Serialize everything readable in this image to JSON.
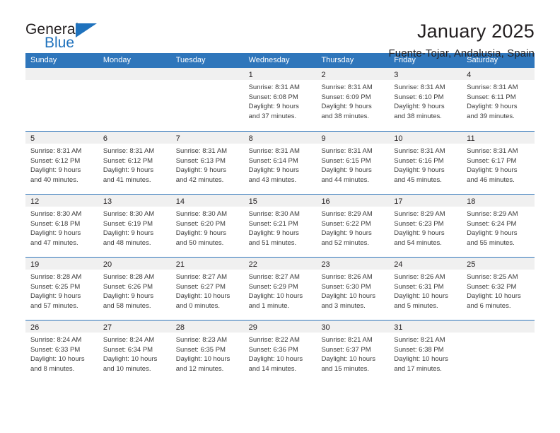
{
  "brand": {
    "name_part1": "General",
    "name_part2": "Blue",
    "accent_color": "#1f72bd",
    "triangle_icon": "triangle-icon"
  },
  "header": {
    "title": "January 2025",
    "subtitle": "Fuente-Tojar, Andalusia, Spain"
  },
  "calendar": {
    "header_bg": "#2f76bb",
    "day_band_bg": "#f0f0f0",
    "weekdays": [
      "Sunday",
      "Monday",
      "Tuesday",
      "Wednesday",
      "Thursday",
      "Friday",
      "Saturday"
    ],
    "weeks": [
      [
        {
          "day": "",
          "lines": []
        },
        {
          "day": "",
          "lines": []
        },
        {
          "day": "",
          "lines": []
        },
        {
          "day": "1",
          "lines": [
            "Sunrise: 8:31 AM",
            "Sunset: 6:08 PM",
            "Daylight: 9 hours",
            "and 37 minutes."
          ]
        },
        {
          "day": "2",
          "lines": [
            "Sunrise: 8:31 AM",
            "Sunset: 6:09 PM",
            "Daylight: 9 hours",
            "and 38 minutes."
          ]
        },
        {
          "day": "3",
          "lines": [
            "Sunrise: 8:31 AM",
            "Sunset: 6:10 PM",
            "Daylight: 9 hours",
            "and 38 minutes."
          ]
        },
        {
          "day": "4",
          "lines": [
            "Sunrise: 8:31 AM",
            "Sunset: 6:11 PM",
            "Daylight: 9 hours",
            "and 39 minutes."
          ]
        }
      ],
      [
        {
          "day": "5",
          "lines": [
            "Sunrise: 8:31 AM",
            "Sunset: 6:12 PM",
            "Daylight: 9 hours",
            "and 40 minutes."
          ]
        },
        {
          "day": "6",
          "lines": [
            "Sunrise: 8:31 AM",
            "Sunset: 6:12 PM",
            "Daylight: 9 hours",
            "and 41 minutes."
          ]
        },
        {
          "day": "7",
          "lines": [
            "Sunrise: 8:31 AM",
            "Sunset: 6:13 PM",
            "Daylight: 9 hours",
            "and 42 minutes."
          ]
        },
        {
          "day": "8",
          "lines": [
            "Sunrise: 8:31 AM",
            "Sunset: 6:14 PM",
            "Daylight: 9 hours",
            "and 43 minutes."
          ]
        },
        {
          "day": "9",
          "lines": [
            "Sunrise: 8:31 AM",
            "Sunset: 6:15 PM",
            "Daylight: 9 hours",
            "and 44 minutes."
          ]
        },
        {
          "day": "10",
          "lines": [
            "Sunrise: 8:31 AM",
            "Sunset: 6:16 PM",
            "Daylight: 9 hours",
            "and 45 minutes."
          ]
        },
        {
          "day": "11",
          "lines": [
            "Sunrise: 8:31 AM",
            "Sunset: 6:17 PM",
            "Daylight: 9 hours",
            "and 46 minutes."
          ]
        }
      ],
      [
        {
          "day": "12",
          "lines": [
            "Sunrise: 8:30 AM",
            "Sunset: 6:18 PM",
            "Daylight: 9 hours",
            "and 47 minutes."
          ]
        },
        {
          "day": "13",
          "lines": [
            "Sunrise: 8:30 AM",
            "Sunset: 6:19 PM",
            "Daylight: 9 hours",
            "and 48 minutes."
          ]
        },
        {
          "day": "14",
          "lines": [
            "Sunrise: 8:30 AM",
            "Sunset: 6:20 PM",
            "Daylight: 9 hours",
            "and 50 minutes."
          ]
        },
        {
          "day": "15",
          "lines": [
            "Sunrise: 8:30 AM",
            "Sunset: 6:21 PM",
            "Daylight: 9 hours",
            "and 51 minutes."
          ]
        },
        {
          "day": "16",
          "lines": [
            "Sunrise: 8:29 AM",
            "Sunset: 6:22 PM",
            "Daylight: 9 hours",
            "and 52 minutes."
          ]
        },
        {
          "day": "17",
          "lines": [
            "Sunrise: 8:29 AM",
            "Sunset: 6:23 PM",
            "Daylight: 9 hours",
            "and 54 minutes."
          ]
        },
        {
          "day": "18",
          "lines": [
            "Sunrise: 8:29 AM",
            "Sunset: 6:24 PM",
            "Daylight: 9 hours",
            "and 55 minutes."
          ]
        }
      ],
      [
        {
          "day": "19",
          "lines": [
            "Sunrise: 8:28 AM",
            "Sunset: 6:25 PM",
            "Daylight: 9 hours",
            "and 57 minutes."
          ]
        },
        {
          "day": "20",
          "lines": [
            "Sunrise: 8:28 AM",
            "Sunset: 6:26 PM",
            "Daylight: 9 hours",
            "and 58 minutes."
          ]
        },
        {
          "day": "21",
          "lines": [
            "Sunrise: 8:27 AM",
            "Sunset: 6:27 PM",
            "Daylight: 10 hours",
            "and 0 minutes."
          ]
        },
        {
          "day": "22",
          "lines": [
            "Sunrise: 8:27 AM",
            "Sunset: 6:29 PM",
            "Daylight: 10 hours",
            "and 1 minute."
          ]
        },
        {
          "day": "23",
          "lines": [
            "Sunrise: 8:26 AM",
            "Sunset: 6:30 PM",
            "Daylight: 10 hours",
            "and 3 minutes."
          ]
        },
        {
          "day": "24",
          "lines": [
            "Sunrise: 8:26 AM",
            "Sunset: 6:31 PM",
            "Daylight: 10 hours",
            "and 5 minutes."
          ]
        },
        {
          "day": "25",
          "lines": [
            "Sunrise: 8:25 AM",
            "Sunset: 6:32 PM",
            "Daylight: 10 hours",
            "and 6 minutes."
          ]
        }
      ],
      [
        {
          "day": "26",
          "lines": [
            "Sunrise: 8:24 AM",
            "Sunset: 6:33 PM",
            "Daylight: 10 hours",
            "and 8 minutes."
          ]
        },
        {
          "day": "27",
          "lines": [
            "Sunrise: 8:24 AM",
            "Sunset: 6:34 PM",
            "Daylight: 10 hours",
            "and 10 minutes."
          ]
        },
        {
          "day": "28",
          "lines": [
            "Sunrise: 8:23 AM",
            "Sunset: 6:35 PM",
            "Daylight: 10 hours",
            "and 12 minutes."
          ]
        },
        {
          "day": "29",
          "lines": [
            "Sunrise: 8:22 AM",
            "Sunset: 6:36 PM",
            "Daylight: 10 hours",
            "and 14 minutes."
          ]
        },
        {
          "day": "30",
          "lines": [
            "Sunrise: 8:21 AM",
            "Sunset: 6:37 PM",
            "Daylight: 10 hours",
            "and 15 minutes."
          ]
        },
        {
          "day": "31",
          "lines": [
            "Sunrise: 8:21 AM",
            "Sunset: 6:38 PM",
            "Daylight: 10 hours",
            "and 17 minutes."
          ]
        },
        {
          "day": "",
          "lines": []
        }
      ]
    ]
  }
}
